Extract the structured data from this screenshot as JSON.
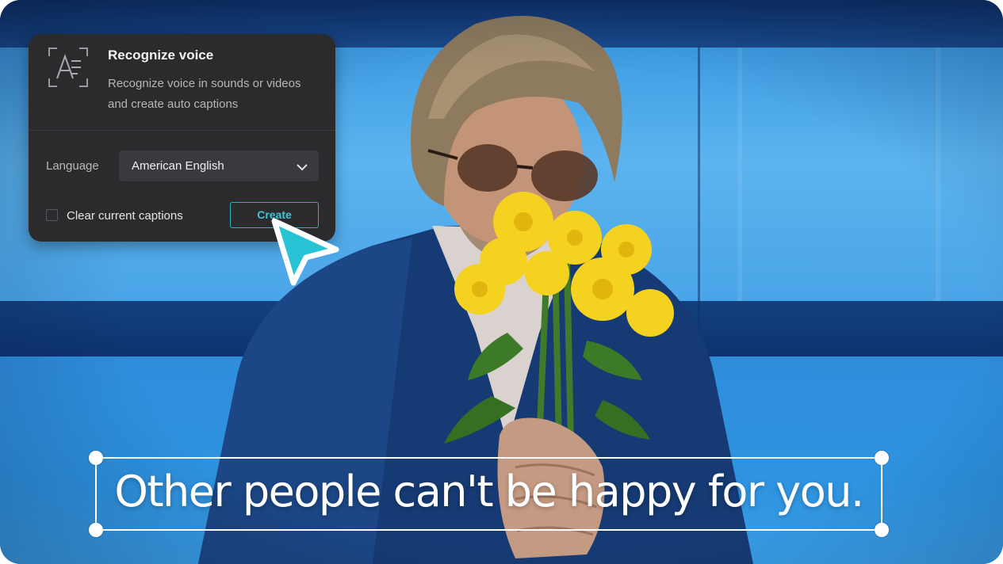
{
  "panel": {
    "title": "Recognize voice",
    "description": "Recognize voice in sounds or videos and create auto captions",
    "icon": "text-recognize-icon",
    "language_label": "Language",
    "language_value": "American English",
    "dropdown_icon": "chevron-down-icon",
    "clear_captions_label": "Clear current captions",
    "clear_captions_checked": false,
    "create_label": "Create",
    "accent_color": "#26b3c7"
  },
  "caption": {
    "text": "Other people can't be happy for you."
  },
  "cursor": {
    "icon": "pointer-cursor-icon",
    "color": "#29c3d6"
  }
}
